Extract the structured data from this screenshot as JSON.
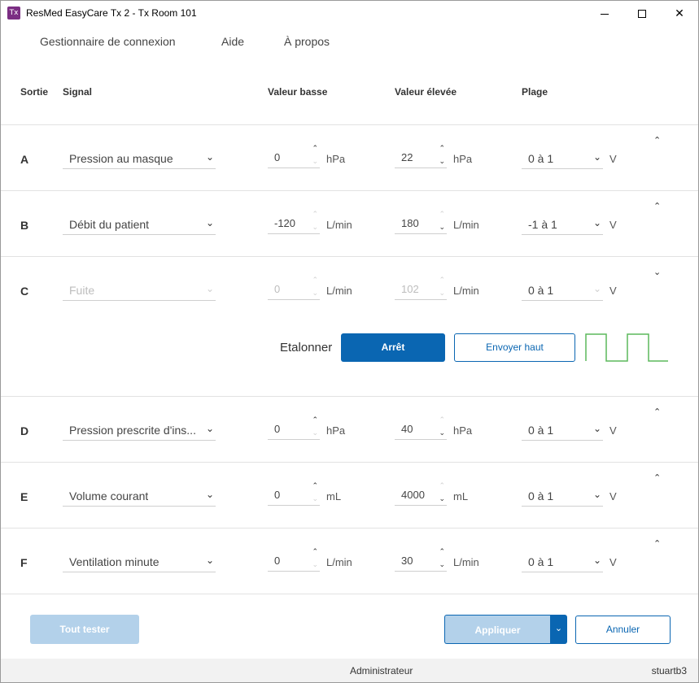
{
  "window": {
    "app_icon": "Tx",
    "title": "ResMed EasyCare Tx 2 - Tx Room 101"
  },
  "menu": [
    "Gestionnaire de connexion",
    "Aide",
    "À propos"
  ],
  "headers": {
    "sortie": "Sortie",
    "signal": "Signal",
    "low": "Valeur basse",
    "high": "Valeur élevée",
    "range": "Plage"
  },
  "rows": [
    {
      "id": "A",
      "signal": "Pression au masque",
      "low": "0",
      "low_unit": "hPa",
      "high": "22",
      "high_unit": "hPa",
      "range": "0 à 1",
      "range_unit": "V",
      "disabled": false
    },
    {
      "id": "B",
      "signal": "Débit du patient",
      "low": "-120",
      "low_unit": "L/min",
      "high": "180",
      "high_unit": "L/min",
      "range": "-1 à 1",
      "range_unit": "V",
      "disabled": false
    },
    {
      "id": "C",
      "signal": "Fuite",
      "low": "0",
      "low_unit": "L/min",
      "high": "102",
      "high_unit": "L/min",
      "range": "0 à 1",
      "range_unit": "V",
      "disabled": true
    },
    {
      "id": "D",
      "signal": "Pression prescrite d'ins...",
      "low": "0",
      "low_unit": "hPa",
      "high": "40",
      "high_unit": "hPa",
      "range": "0 à 1",
      "range_unit": "V",
      "disabled": false
    },
    {
      "id": "E",
      "signal": "Volume courant",
      "low": "0",
      "low_unit": "mL",
      "high": "4000",
      "high_unit": "mL",
      "range": "0 à 1",
      "range_unit": "V",
      "disabled": false
    },
    {
      "id": "F",
      "signal": "Ventilation minute",
      "low": "0",
      "low_unit": "L/min",
      "high": "30",
      "high_unit": "L/min",
      "range": "0 à 1",
      "range_unit": "V",
      "disabled": false
    }
  ],
  "calibration": {
    "label": "Etalonner",
    "off_button": "Arrêt",
    "send_high_button": "Envoyer haut",
    "wave_color": "#5cb85c"
  },
  "footer": {
    "test_all": "Tout tester",
    "apply": "Appliquer",
    "cancel": "Annuler"
  },
  "status": {
    "role": "Administrateur",
    "user": "stuartb3"
  },
  "colors": {
    "primary": "#0a66b2",
    "primary_disabled": "#b3d1ea",
    "app_icon": "#7b2e83"
  }
}
